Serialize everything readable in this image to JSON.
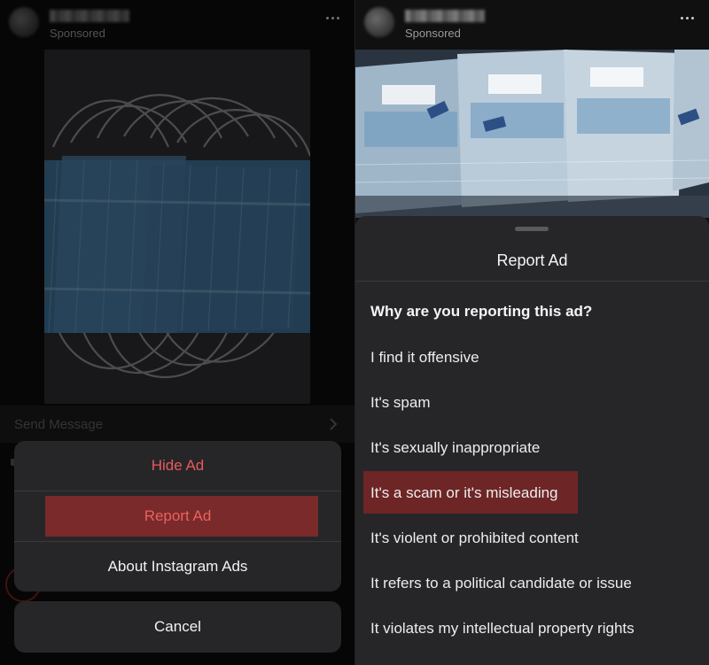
{
  "left_panel": {
    "post": {
      "sponsored_label": "Sponsored",
      "more_icon": "more-horizontal-icon"
    },
    "send_message_label": "Send Message",
    "action_sheet": {
      "items": [
        {
          "label": "Hide Ad",
          "color": "#e85a5a"
        },
        {
          "label": "Report Ad",
          "color": "#e8625f",
          "highlighted": true
        },
        {
          "label": "About Instagram Ads",
          "color": "#f2f2f2"
        }
      ],
      "cancel_label": "Cancel"
    }
  },
  "right_panel": {
    "post": {
      "sponsored_label": "Sponsored",
      "more_icon": "more-horizontal-icon"
    },
    "report_sheet": {
      "title": "Report Ad",
      "question": "Why are you reporting this ad?",
      "reasons": [
        "I find it offensive",
        "It's spam",
        "It's sexually inappropriate",
        "It's a scam or it's misleading",
        "It's violent or prohibited content",
        "It refers to a political candidate or issue",
        "It violates my intellectual property rights"
      ],
      "highlighted_reason": "It's a scam or it's misleading"
    }
  },
  "colors": {
    "sheet_background": "#262628",
    "highlight": "#7a2a2b",
    "destructive": "#e85a5a"
  }
}
